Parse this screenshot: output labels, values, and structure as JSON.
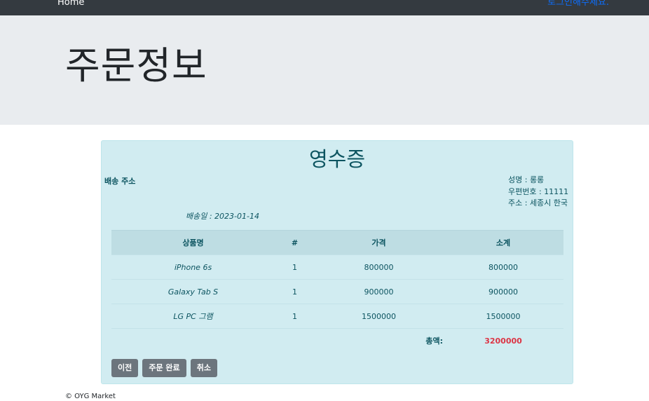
{
  "nav": {
    "home": "Home",
    "login": "로그인해주세요."
  },
  "page": {
    "title": "주문정보"
  },
  "receipt": {
    "title": "영수증",
    "ship_label": "배송 주소",
    "customer": {
      "name": "성명 : 롱롱",
      "zip": "우편번호 : 11111",
      "address": "주소 : 세종시 한국"
    },
    "ship_date": "배송일 : 2023-01-14",
    "headers": [
      "상품명",
      "#",
      "가격",
      "소계"
    ],
    "items": [
      {
        "name": "iPhone 6s",
        "qty": "1",
        "price": "800000",
        "subtotal": "800000"
      },
      {
        "name": "Galaxy Tab S",
        "qty": "1",
        "price": "900000",
        "subtotal": "900000"
      },
      {
        "name": "LG PC 그램",
        "qty": "1",
        "price": "1500000",
        "subtotal": "1500000"
      }
    ],
    "total_label": "총액:",
    "total_amount": "3200000",
    "buttons": {
      "prev": "이전",
      "complete": "주문 완료",
      "cancel": "취소"
    }
  },
  "footer": {
    "text": "© OYG Market"
  },
  "colors": {
    "accent": "#0d6efd",
    "info_bg": "#d1ecf1",
    "total": "#dc3545",
    "button": "#6c757d"
  }
}
